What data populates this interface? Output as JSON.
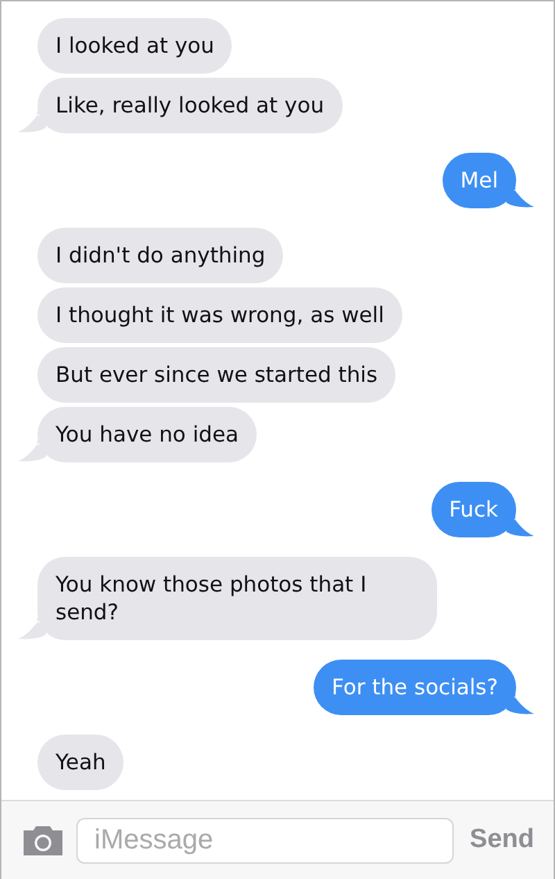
{
  "messages": [
    {
      "kind": "received",
      "text": "I looked at you",
      "tail": false
    },
    {
      "kind": "received",
      "text": "Like, really looked at you",
      "tail": true
    },
    {
      "kind": "sent",
      "text": "Mel",
      "tail": true
    },
    {
      "kind": "received",
      "text": "I didn't do anything",
      "tail": false
    },
    {
      "kind": "received",
      "text": "I thought it was wrong, as well",
      "tail": false
    },
    {
      "kind": "received",
      "text": "But ever since we started this",
      "tail": false
    },
    {
      "kind": "received",
      "text": "You have no idea",
      "tail": true
    },
    {
      "kind": "sent",
      "text": "Fuck",
      "tail": true
    },
    {
      "kind": "received",
      "text": "You know those photos that I send?",
      "tail": true
    },
    {
      "kind": "sent",
      "text": "For the socials?",
      "tail": true
    },
    {
      "kind": "received",
      "text": "Yeah",
      "tail": false
    }
  ],
  "compose": {
    "placeholder": "iMessage",
    "send": "Send"
  }
}
